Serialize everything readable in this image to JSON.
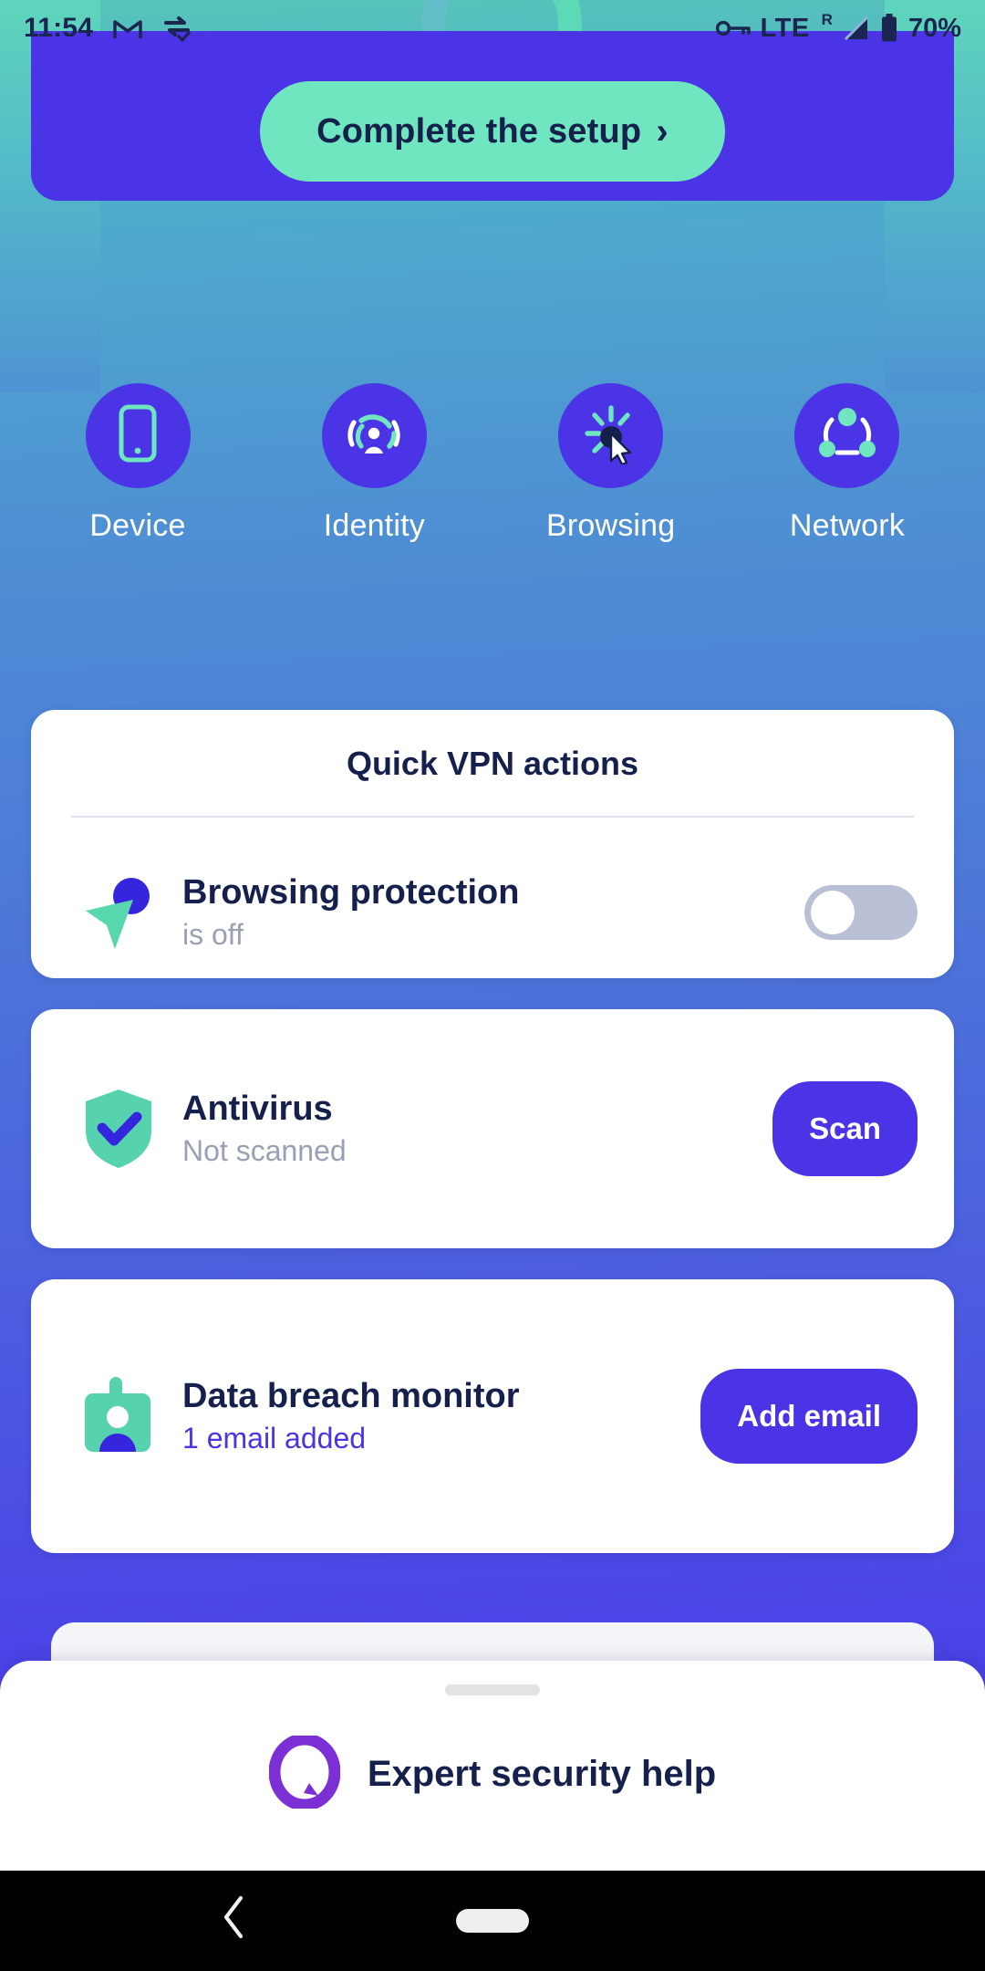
{
  "status_bar": {
    "time": "11:54",
    "icons_left": [
      "gmail-icon",
      "app-sync-icon"
    ],
    "vpn_key_icon": "key-icon",
    "network": "LTE",
    "roaming": "R",
    "signal_icon": "signal-triangle-icon",
    "battery_icon": "battery-icon",
    "battery": "70%"
  },
  "banner": {
    "button_label": "Complete the setup",
    "chevron": "›",
    "bg_color": "#4a34e6",
    "button_color": "#6fe6c0"
  },
  "categories": [
    {
      "label": "Device",
      "icon": "smartphone-icon"
    },
    {
      "label": "Identity",
      "icon": "identity-fingerprint-icon"
    },
    {
      "label": "Browsing",
      "icon": "cursor-click-icon"
    },
    {
      "label": "Network",
      "icon": "network-nodes-icon"
    }
  ],
  "vpn_card": {
    "title": "Quick VPN actions",
    "row": {
      "icon": "navigation-arrow-icon",
      "title": "Browsing protection",
      "subtitle": "is off",
      "toggle_state": "off"
    }
  },
  "antivirus_card": {
    "icon": "shield-check-icon",
    "title": "Antivirus",
    "subtitle": "Not scanned",
    "button_label": "Scan"
  },
  "breach_card": {
    "icon": "id-badge-icon",
    "title": "Data breach monitor",
    "subtitle": "1 email added",
    "button_label": "Add email"
  },
  "bottom_sheet": {
    "icon": "chat-bubble-ring-icon",
    "label": "Expert security help"
  },
  "nav_bar": {
    "back_icon": "back-chevron-icon",
    "home_icon": "home-pill-icon"
  },
  "colors": {
    "brand_purple": "#4a34e6",
    "brand_green": "#6fe6c0",
    "text_dark": "#16204c",
    "text_muted": "#9aa0b4",
    "purple_accent": "#7b2fd4"
  }
}
